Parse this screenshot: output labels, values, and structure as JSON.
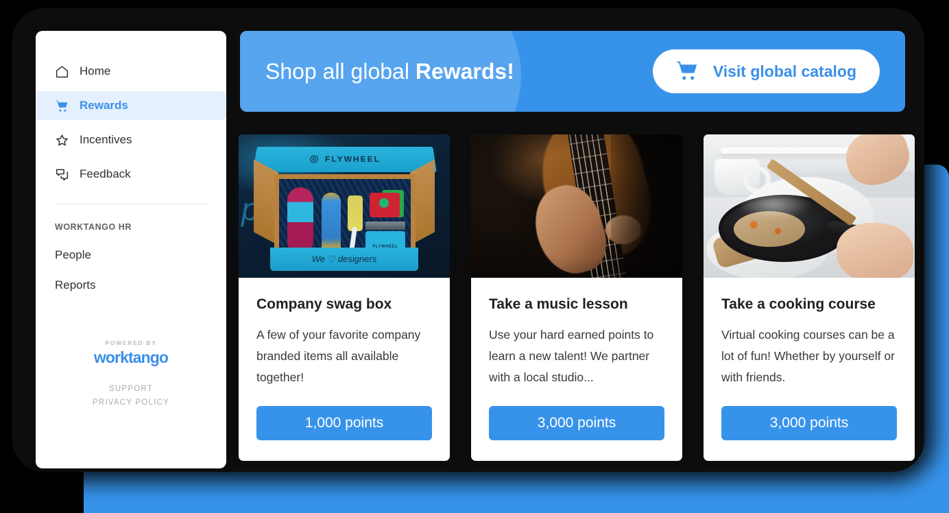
{
  "sidebar": {
    "nav": [
      {
        "label": "Home",
        "icon": "home-icon",
        "active": false
      },
      {
        "label": "Rewards",
        "icon": "cart-icon",
        "active": true
      },
      {
        "label": "Incentives",
        "icon": "star-icon",
        "active": false
      },
      {
        "label": "Feedback",
        "icon": "chat-icon",
        "active": false
      }
    ],
    "section_label": "WORKTANGO HR",
    "sub_items": [
      {
        "label": "People"
      },
      {
        "label": "Reports"
      }
    ],
    "footer": {
      "powered_by": "POWERED BY",
      "brand": "worktango",
      "links": [
        {
          "label": "SUPPORT"
        },
        {
          "label": "PRIVACY POLICY"
        }
      ]
    }
  },
  "banner": {
    "title_light": "Shop all global ",
    "title_bold": "Rewards!",
    "cta_label": "Visit global catalog",
    "cta_icon": "shopping-cart-icon"
  },
  "cards": [
    {
      "title": "Company swag box",
      "description": "A few of your favorite company branded items all available together!",
      "points_label": "1,000 points",
      "image_alt": "open cyan FLYWHEEL branded swag box with shirt, bottle and notebook",
      "image_text_lid": "FLYWHEEL",
      "image_text_front": "We ♡ designers",
      "image_text_notebook": "FLYWHEEL"
    },
    {
      "title": "Take a music lesson",
      "description": "Use your hard earned points to learn a new talent! We partner with a local studio...",
      "points_label": "3,000 points",
      "image_alt": "hands playing an acoustic guitar in warm dim light"
    },
    {
      "title": "Take a cooking course",
      "description": "Virtual cooking courses can be a lot of fun! Whether by yourself or with friends.",
      "points_label": "3,000 points",
      "image_alt": "hands stirring food in a black pan with a wooden spatula"
    }
  ],
  "colors": {
    "brand_blue": "#3793ea",
    "light_blue": "#57a4ef",
    "active_nav_bg": "#e4f0fd",
    "frame_black": "#0d0d0d"
  }
}
